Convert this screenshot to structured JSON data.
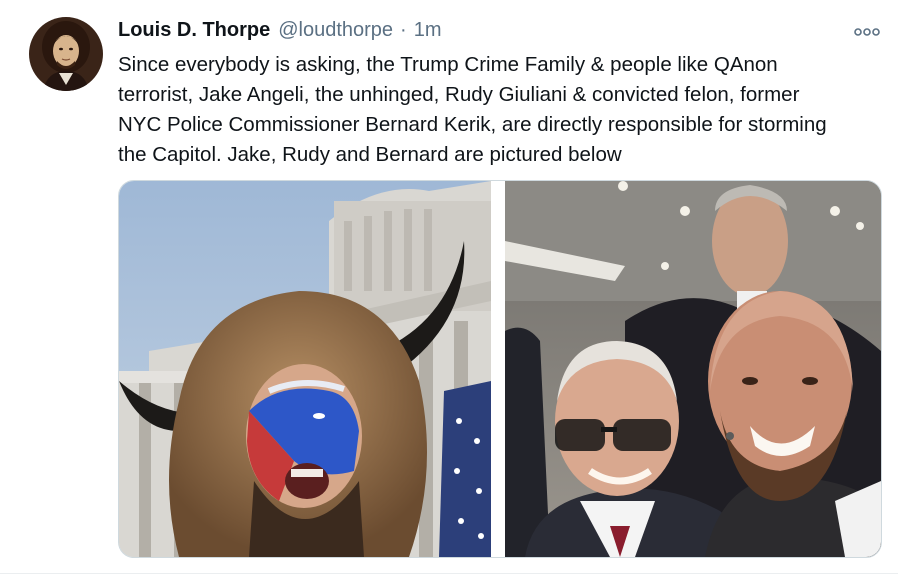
{
  "tweet": {
    "display_name": "Louis D. Thorpe",
    "handle": "@loudthorpe",
    "separator": "·",
    "time": "1m",
    "more_icon": "more-dots-icon",
    "text_lines": [
      "Since everybody is asking, the Trump Crime Family & people like QAnon",
      "terrorist, Jake Angeli, the unhinged, Rudy Giuliani & convicted felon, former",
      "NYC Police Commissioner Bernard Kerik, are directly responsible for storming",
      "the Capitol. Jake, Rudy and Bernard are pictured below"
    ]
  },
  "colors": {
    "primary_text": "#0f1419",
    "secondary_text": "#5b7083",
    "border": "#cfd9de"
  }
}
